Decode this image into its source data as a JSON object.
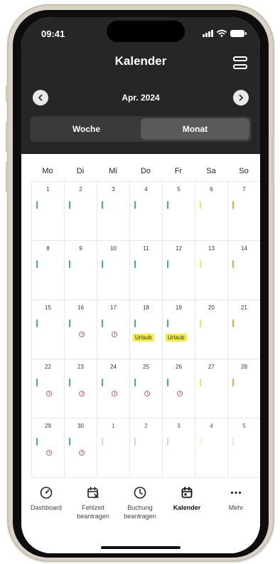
{
  "status": {
    "time": "09:41"
  },
  "header": {
    "title": "Kalender",
    "month": "Apr. 2024"
  },
  "segments": [
    {
      "label": "Woche",
      "active": false
    },
    {
      "label": "Monat",
      "active": true
    }
  ],
  "weekdays": [
    "Mo",
    "Di",
    "Mi",
    "Do",
    "Fr",
    "Sa",
    "So"
  ],
  "colors": {
    "blue": "#5b9ee0",
    "green": "#3db38a",
    "yellow": "#e6ee57",
    "orange": "#f0a63b",
    "clock": "#d35b5b",
    "badge": "#f5ef3c"
  },
  "days": [
    {
      "num": "1",
      "bar": "blue"
    },
    {
      "num": "2",
      "bar": "green"
    },
    {
      "num": "3",
      "bar": "green"
    },
    {
      "num": "4",
      "bar": "green"
    },
    {
      "num": "5",
      "bar": "green"
    },
    {
      "num": "6",
      "bar": "yellow"
    },
    {
      "num": "7",
      "bar": "orange"
    },
    {
      "num": "8",
      "bar": "green"
    },
    {
      "num": "9",
      "bar": "green"
    },
    {
      "num": "10",
      "bar": "green"
    },
    {
      "num": "11",
      "bar": "green"
    },
    {
      "num": "12",
      "bar": "green"
    },
    {
      "num": "13",
      "bar": "yellow"
    },
    {
      "num": "14",
      "bar": "orange"
    },
    {
      "num": "15",
      "bar": "green"
    },
    {
      "num": "16",
      "bar": "green",
      "clock": true
    },
    {
      "num": "17",
      "bar": "green",
      "clock": true
    },
    {
      "num": "18",
      "bar": "green",
      "badge": "Urlaub"
    },
    {
      "num": "19",
      "bar": "green",
      "badge": "Urlaub"
    },
    {
      "num": "20",
      "bar": "yellow"
    },
    {
      "num": "21",
      "bar": "orange"
    },
    {
      "num": "22",
      "bar": "green",
      "clock": true
    },
    {
      "num": "23",
      "bar": "green",
      "clock": true
    },
    {
      "num": "24",
      "bar": "green",
      "clock": true
    },
    {
      "num": "25",
      "bar": "green",
      "clock": true
    },
    {
      "num": "26",
      "bar": "green",
      "clock": true
    },
    {
      "num": "27",
      "bar": "yellow"
    },
    {
      "num": "28",
      "bar": "orange"
    },
    {
      "num": "29",
      "bar": "green",
      "clock": true
    },
    {
      "num": "30",
      "bar": "green",
      "clock": true
    },
    {
      "num": "1",
      "bar": "blue",
      "faded": true
    },
    {
      "num": "2",
      "bar": "green",
      "faded": true
    },
    {
      "num": "3",
      "bar": "green",
      "faded": true
    },
    {
      "num": "4",
      "bar": "yellow",
      "faded": true
    },
    {
      "num": "5",
      "bar": "orange",
      "faded": true
    }
  ],
  "tabs": [
    {
      "line1": "Dashboard",
      "line2": "",
      "icon": "gauge-icon",
      "active": false
    },
    {
      "line1": "Fehlzeit",
      "line2": "beantragen",
      "icon": "calendar-x-icon",
      "active": false
    },
    {
      "line1": "Buchung",
      "line2": "beantragen",
      "icon": "clock-icon",
      "active": false
    },
    {
      "line1": "Kalender",
      "line2": "",
      "icon": "calendar-icon",
      "active": true
    },
    {
      "line1": "Mehr",
      "line2": "",
      "icon": "more-icon",
      "active": false
    }
  ]
}
